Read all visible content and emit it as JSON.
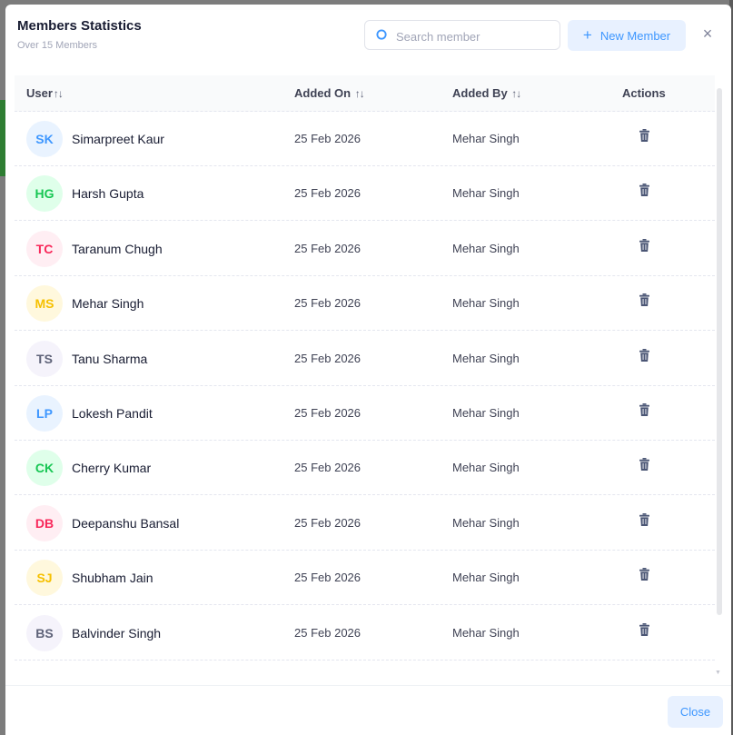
{
  "header": {
    "title": "Members Statistics",
    "subtitle": "Over 15 Members",
    "search_placeholder": "Search member",
    "new_member_label": "New Member"
  },
  "table": {
    "columns": {
      "user": "User",
      "added_on": "Added On",
      "added_by": "Added By",
      "actions": "Actions"
    },
    "rows": [
      {
        "initials": "SK",
        "name": "Simarpreet Kaur",
        "added_on": "25 Feb 2026",
        "added_by": "Mehar Singh",
        "avatar_bg": "#e9f3ff",
        "avatar_fg": "#3e97ff"
      },
      {
        "initials": "HG",
        "name": "Harsh Gupta",
        "added_on": "25 Feb 2026",
        "added_by": "Mehar Singh",
        "avatar_bg": "#dfffea",
        "avatar_fg": "#17c653"
      },
      {
        "initials": "TC",
        "name": "Taranum Chugh",
        "added_on": "25 Feb 2026",
        "added_by": "Mehar Singh",
        "avatar_bg": "#ffeef3",
        "avatar_fg": "#f8285a"
      },
      {
        "initials": "MS",
        "name": "Mehar Singh",
        "added_on": "25 Feb 2026",
        "added_by": "Mehar Singh",
        "avatar_bg": "#fff8dd",
        "avatar_fg": "#f6c000"
      },
      {
        "initials": "TS",
        "name": "Tanu Sharma",
        "added_on": "25 Feb 2026",
        "added_by": "Mehar Singh",
        "avatar_bg": "#f5f3fb",
        "avatar_fg": "#5e6278"
      },
      {
        "initials": "LP",
        "name": "Lokesh Pandit",
        "added_on": "25 Feb 2026",
        "added_by": "Mehar Singh",
        "avatar_bg": "#e9f3ff",
        "avatar_fg": "#3e97ff"
      },
      {
        "initials": "CK",
        "name": "Cherry Kumar",
        "added_on": "25 Feb 2026",
        "added_by": "Mehar Singh",
        "avatar_bg": "#dfffea",
        "avatar_fg": "#17c653"
      },
      {
        "initials": "DB",
        "name": "Deepanshu Bansal",
        "added_on": "25 Feb 2026",
        "added_by": "Mehar Singh",
        "avatar_bg": "#ffeef3",
        "avatar_fg": "#f8285a"
      },
      {
        "initials": "SJ",
        "name": "Shubham Jain",
        "added_on": "25 Feb 2026",
        "added_by": "Mehar Singh",
        "avatar_bg": "#fff8dd",
        "avatar_fg": "#f6c000"
      },
      {
        "initials": "BS",
        "name": "Balvinder Singh",
        "added_on": "25 Feb 2026",
        "added_by": "Mehar Singh",
        "avatar_bg": "#f5f3fb",
        "avatar_fg": "#5e6278"
      }
    ]
  },
  "footer": {
    "close_label": "Close"
  },
  "icons": {
    "search": "search-icon",
    "plus": "plus-icon",
    "close": "close-icon",
    "sort": "sort-icon",
    "delete": "trash-icon"
  },
  "colors": {
    "accent": "#3e97ff",
    "accent_light": "#e8f1ff"
  }
}
